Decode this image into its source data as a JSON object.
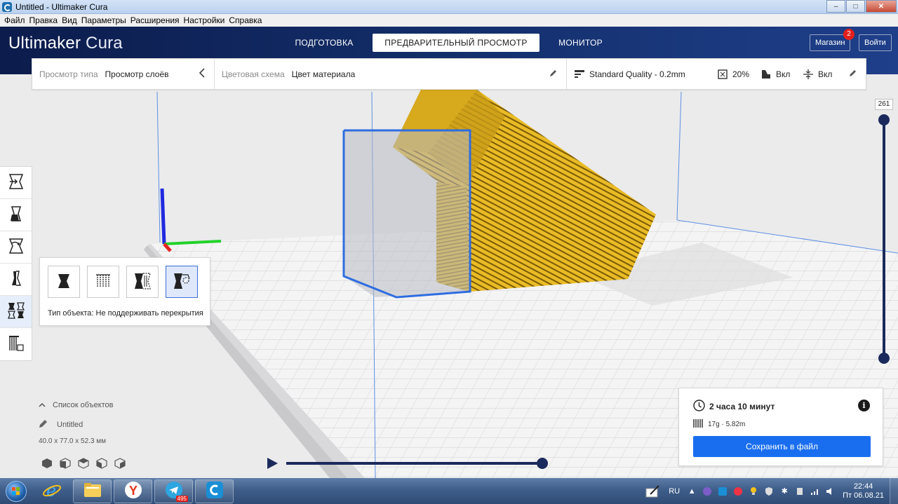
{
  "window": {
    "title": "Untitled - Ultimaker Cura",
    "controls": [
      "minimize",
      "maximize",
      "close"
    ]
  },
  "menu": [
    "Файл",
    "Правка",
    "Вид",
    "Параметры",
    "Расширения",
    "Настройки",
    "Справка"
  ],
  "header": {
    "brand_primary": "Ultimaker",
    "brand_secondary": "Cura",
    "tabs": [
      {
        "label": "ПОДГОТОВКА",
        "active": false
      },
      {
        "label": "ПРЕДВАРИТЕЛЬНЫЙ ПРОСМОТР",
        "active": true
      },
      {
        "label": "МОНИТОР",
        "active": false
      }
    ],
    "marketplace_label": "Магазин",
    "marketplace_badge": "2",
    "signin_label": "Войти"
  },
  "settings_bar": {
    "view_type_label": "Просмотр типа",
    "view_type_value": "Просмотр слоёв",
    "color_scheme_label": "Цветовая схема",
    "color_scheme_value": "Цвет материала",
    "quality": "Standard Quality - 0.2mm",
    "infill": "20%",
    "support": "Вкл",
    "adhesion": "Вкл"
  },
  "toolbar": {
    "tools": [
      "move-tool",
      "scale-tool",
      "rotate-tool",
      "mirror-tool",
      "per-model-settings-tool",
      "support-blocker-tool"
    ],
    "active_index": 4
  },
  "tool_panel": {
    "mesh_types": [
      "normal-model",
      "print-as-support",
      "modify-overlaps",
      "dont-support-overlaps"
    ],
    "active_index": 3,
    "label": "Тип объекта: Не поддерживать перекрытия"
  },
  "object_list": {
    "header": "Список объектов",
    "item_name": "Untitled",
    "dimensions": "40.0 x 77.0 x 52.3 мм"
  },
  "layer_slider": {
    "max_layer": "261"
  },
  "simulation": {
    "progress": 1.0
  },
  "print_info": {
    "time": "2 часа 10 минут",
    "material": "17g · 5.82m",
    "save_label": "Сохранить в файл"
  },
  "taskbar": {
    "apps": [
      "internet-explorer",
      "file-explorer",
      "yandex-browser",
      "telegram",
      "cura"
    ],
    "telegram_badge": "495",
    "language": "RU",
    "time": "22:44",
    "date": "Пт 06.08.21"
  },
  "colors": {
    "header_dark": "#0c1c4c",
    "accent_blue": "#196ef0",
    "model_yellow": "#e8b81e",
    "badge_red": "#e3201b"
  }
}
